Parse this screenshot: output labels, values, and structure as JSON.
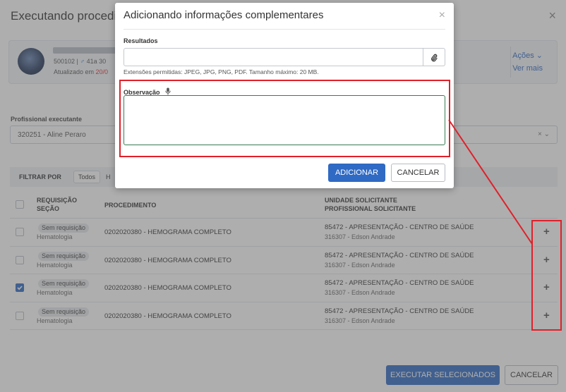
{
  "background": {
    "title": "Executando procedim",
    "patient": {
      "info_prefix": "500102 | ",
      "sex_symbol": "♂",
      "age": " 41a 30",
      "updated_prefix": "Atualizado em ",
      "updated_date": "20/0"
    },
    "actions_label": "Ações ⌄",
    "see_more_label": "Ver mais",
    "professional_label": "Profissional executante",
    "professional_value": "320251 - Aline Peraro",
    "professional_controls": "× ⌄",
    "filter_label": "FILTRAR POR",
    "filter_all": "Todos",
    "filter_second": "H",
    "table": {
      "headers": {
        "req_line1": "REQUISIÇÃO",
        "req_line2": "SEÇÃO",
        "procedure": "PROCEDIMENTO",
        "unit_line1": "UNIDADE SOLICITANTE",
        "unit_line2": "PROFISSIONAL SOLICITANTE"
      },
      "rows": [
        {
          "badge": "Sem requisição",
          "section": "Hematologia",
          "procedure": "0202020380 - HEMOGRAMA COMPLETO",
          "unit": "85472 - APRESENTAÇÃO - CENTRO DE SAÚDE",
          "professional": "316307 - Edson Andrade",
          "checked": false
        },
        {
          "badge": "Sem requisição",
          "section": "Hematologia",
          "procedure": "0202020380 - HEMOGRAMA COMPLETO",
          "unit": "85472 - APRESENTAÇÃO - CENTRO DE SAÚDE",
          "professional": "316307 - Edson Andrade",
          "checked": false
        },
        {
          "badge": "Sem requisição",
          "section": "Hematologia",
          "procedure": "0202020380 - HEMOGRAMA COMPLETO",
          "unit": "85472 - APRESENTAÇÃO - CENTRO DE SAÚDE",
          "professional": "316307 - Edson Andrade",
          "checked": true
        },
        {
          "badge": "Sem requisição",
          "section": "Hematologia",
          "procedure": "0202020380 - HEMOGRAMA COMPLETO",
          "unit": "85472 - APRESENTAÇÃO - CENTRO DE SAÚDE",
          "professional": "316307 - Edson Andrade",
          "checked": false
        }
      ]
    },
    "execute_button": "EXECUTAR SELECIONADOS",
    "cancel_button": "CANCELAR"
  },
  "modal": {
    "title": "Adicionando informações complementares",
    "close_glyph": "×",
    "results_label": "Resultados",
    "results_value": "",
    "allowed_ext": "Extensões permitidas: JPEG, JPG, PNG, PDF. Tamanho máximo: 20 MB.",
    "observation_label": "Observação",
    "observation_value": "",
    "add_button": "ADICIONAR",
    "cancel_button": "CANCELAR"
  },
  "icons": {
    "close": "close-icon",
    "attach": "paperclip-icon",
    "mic": "microphone-icon",
    "plus": "plus-icon",
    "check": "check-icon"
  },
  "colors": {
    "primary": "#2f6ac4",
    "annotation": "#e0202a",
    "focus_border": "#3a7a53",
    "overlay": "rgba(85,85,85,0.48)"
  }
}
